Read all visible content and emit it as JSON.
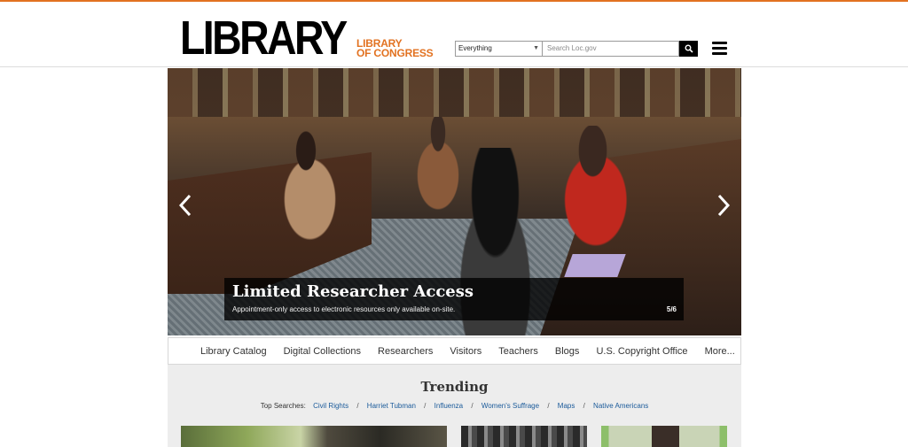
{
  "header": {
    "logo_main": "LIBRARY",
    "logo_sub_line1": "LIBRARY",
    "logo_sub_line2": "OF CONGRESS",
    "search_scope": "Everything",
    "search_placeholder": "Search Loc.gov",
    "search_icon": "search-icon",
    "menu_icon": "hamburger-menu-icon"
  },
  "hero": {
    "title": "Limited Researcher Access",
    "description": "Appointment-only access to electronic resources only available on-site.",
    "counter": "5/6",
    "prev_icon": "chevron-left-icon",
    "next_icon": "chevron-right-icon"
  },
  "nav": {
    "items": [
      {
        "label": "Library Catalog"
      },
      {
        "label": "Digital Collections"
      },
      {
        "label": "Researchers"
      },
      {
        "label": "Visitors"
      },
      {
        "label": "Teachers"
      },
      {
        "label": "Blogs"
      },
      {
        "label": "U.S. Copyright Office"
      },
      {
        "label": "More..."
      }
    ]
  },
  "trending": {
    "title": "Trending",
    "top_searches_label": "Top Searches:",
    "links": [
      {
        "label": "Civil Rights"
      },
      {
        "label": "Harriet Tubman"
      },
      {
        "label": "Influenza"
      },
      {
        "label": "Women's Suffrage"
      },
      {
        "label": "Maps"
      },
      {
        "label": "Native Americans"
      }
    ],
    "separator": "/"
  },
  "colors": {
    "accent": "#e27221",
    "link": "#1a5a9a",
    "nav_text": "#333333",
    "trending_bg": "#ededed"
  }
}
